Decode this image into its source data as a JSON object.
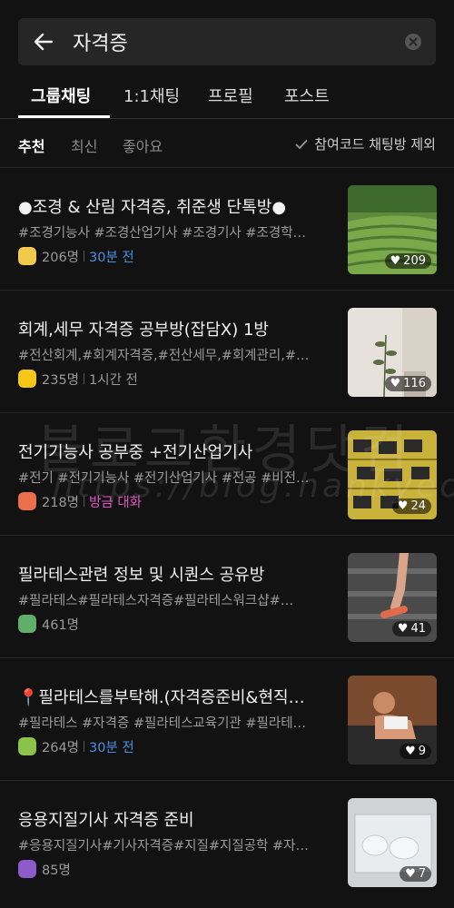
{
  "search": {
    "query": "자격증"
  },
  "tabs": [
    "그룹채팅",
    "1:1채팅",
    "프로필",
    "포스트"
  ],
  "filters": {
    "sort_options": [
      "추천",
      "최신",
      "좋아요"
    ],
    "exclude_label": "참여코드 채팅방 제외"
  },
  "rooms": [
    {
      "title": "●조경 & 산림 자격증, 취준생 단톡방●",
      "tags": "#조경기능사 #조경산업기사 #조경기사 #조경학…",
      "members": "206명",
      "activity": "30분 전",
      "activity_color": "#4a90e2",
      "likes": "209",
      "avatar_color": "#f2c94c"
    },
    {
      "title": "회계,세무 자격증 공부방(잡담X) 1방",
      "tags": "#전산회계,#회계자격증,#전산세무,#회계관리,#…",
      "members": "235명",
      "activity": "1시간 전",
      "activity_color": "#9a9a9a",
      "likes": "116",
      "avatar_color": "#f5c518"
    },
    {
      "title": "전기기능사 공부중 +전기산업기사",
      "tags": "#전기 #전기기능사 #전기산업기사 #전공 #비전…",
      "members": "218명",
      "activity": "방금 대화",
      "activity_color": "#e056c1",
      "likes": "24",
      "avatar_color": "#e8704a"
    },
    {
      "title": "필라테스관련 정보 및 시퀀스 공유방",
      "tags": "#필라테스#필라테스자격증#필라테스워크샵#…",
      "members": "461명",
      "activity": "",
      "activity_color": "#9a9a9a",
      "likes": "41",
      "avatar_color": "#5fae6a"
    },
    {
      "title": "📍필라테스를부탁해.(자격증준비&현직…",
      "tags": "#필라테스 #자격증 #필라테스교육기관 #필라테…",
      "members": "264명",
      "activity": "30분 전",
      "activity_color": "#4a90e2",
      "likes": "9",
      "avatar_color": "#8bc34a"
    },
    {
      "title": "응용지질기사 자격증 준비",
      "tags": "#응용지질기사#기사자격증#지질#지질공학 #자…",
      "members": "85명",
      "activity": "",
      "activity_color": "#9a9a9a",
      "likes": "7",
      "avatar_color": "#8e5cc8"
    }
  ],
  "watermark": {
    "text": "블로그한경닷컴",
    "url": "https://blog.hankyeong.com"
  }
}
